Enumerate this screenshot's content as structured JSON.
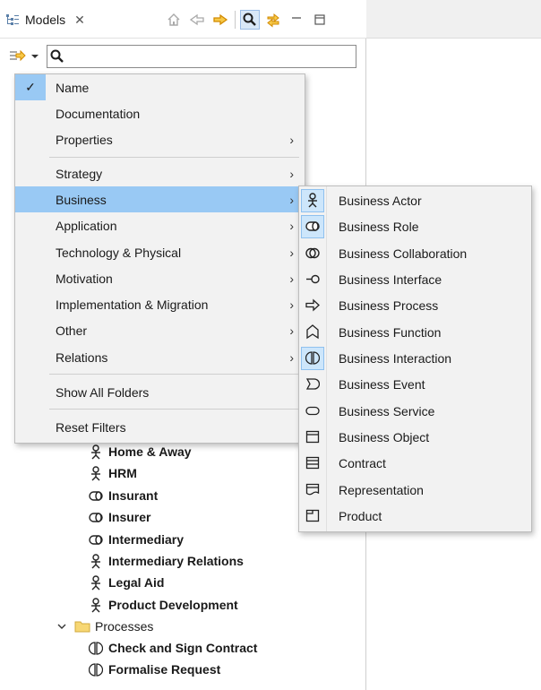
{
  "panel": {
    "tab_label": "Models",
    "close_glyph": "✕",
    "toolbar_icons": [
      "home-icon",
      "back-icon",
      "forward-icon",
      "search-icon",
      "link-icon",
      "minimize-icon",
      "maximize-icon"
    ]
  },
  "search": {
    "value": "",
    "placeholder": ""
  },
  "filter_menu": {
    "items": [
      {
        "label": "Name",
        "checked": true
      },
      {
        "label": "Documentation"
      },
      {
        "label": "Properties",
        "submenu": true
      },
      {
        "label": "Strategy",
        "submenu": true
      },
      {
        "label": "Business",
        "submenu": true,
        "highlighted": true
      },
      {
        "label": "Application",
        "submenu": true
      },
      {
        "label": "Technology & Physical",
        "submenu": true
      },
      {
        "label": "Motivation",
        "submenu": true
      },
      {
        "label": "Implementation & Migration",
        "submenu": true
      },
      {
        "label": "Other",
        "submenu": true
      },
      {
        "label": "Relations",
        "submenu": true
      },
      {
        "label": "Show All Folders"
      },
      {
        "label": "Reset Filters"
      }
    ],
    "arrow": "›",
    "check_glyph": "✓"
  },
  "business_menu": {
    "items": [
      {
        "label": "Business Actor",
        "icon": "actor-icon",
        "selected": true
      },
      {
        "label": "Business Role",
        "icon": "role-icon",
        "selected": true
      },
      {
        "label": "Business Collaboration",
        "icon": "collaboration-icon"
      },
      {
        "label": "Business Interface",
        "icon": "interface-icon"
      },
      {
        "label": "Business Process",
        "icon": "process-icon"
      },
      {
        "label": "Business Function",
        "icon": "function-icon"
      },
      {
        "label": "Business Interaction",
        "icon": "interaction-icon",
        "selected": true
      },
      {
        "label": "Business Event",
        "icon": "event-icon"
      },
      {
        "label": "Business Service",
        "icon": "service-icon"
      },
      {
        "label": "Business Object",
        "icon": "object-icon"
      },
      {
        "label": "Contract",
        "icon": "contract-icon"
      },
      {
        "label": "Representation",
        "icon": "representation-icon"
      },
      {
        "label": "Product",
        "icon": "product-icon"
      }
    ]
  },
  "tree": {
    "items": [
      {
        "label": "Home & Away",
        "icon": "actor-icon"
      },
      {
        "label": "HRM",
        "icon": "actor-icon"
      },
      {
        "label": "Insurant",
        "icon": "role-icon"
      },
      {
        "label": "Insurer",
        "icon": "role-icon"
      },
      {
        "label": "Intermediary",
        "icon": "role-icon"
      },
      {
        "label": "Intermediary Relations",
        "icon": "actor-icon"
      },
      {
        "label": "Legal Aid",
        "icon": "actor-icon"
      },
      {
        "label": "Product Development",
        "icon": "actor-icon"
      }
    ],
    "folder": {
      "label": "Processes",
      "icon": "folder-icon",
      "expanded": true
    },
    "folder_items": [
      {
        "label": "Check and Sign Contract",
        "icon": "interaction-icon"
      },
      {
        "label": "Formalise Request",
        "icon": "interaction-icon"
      }
    ]
  },
  "colors": {
    "highlight": "#99c9f4",
    "menu_bg": "#f2f2f2",
    "accent_orange": "#f5a623",
    "folder_yellow": "#f7d774"
  }
}
